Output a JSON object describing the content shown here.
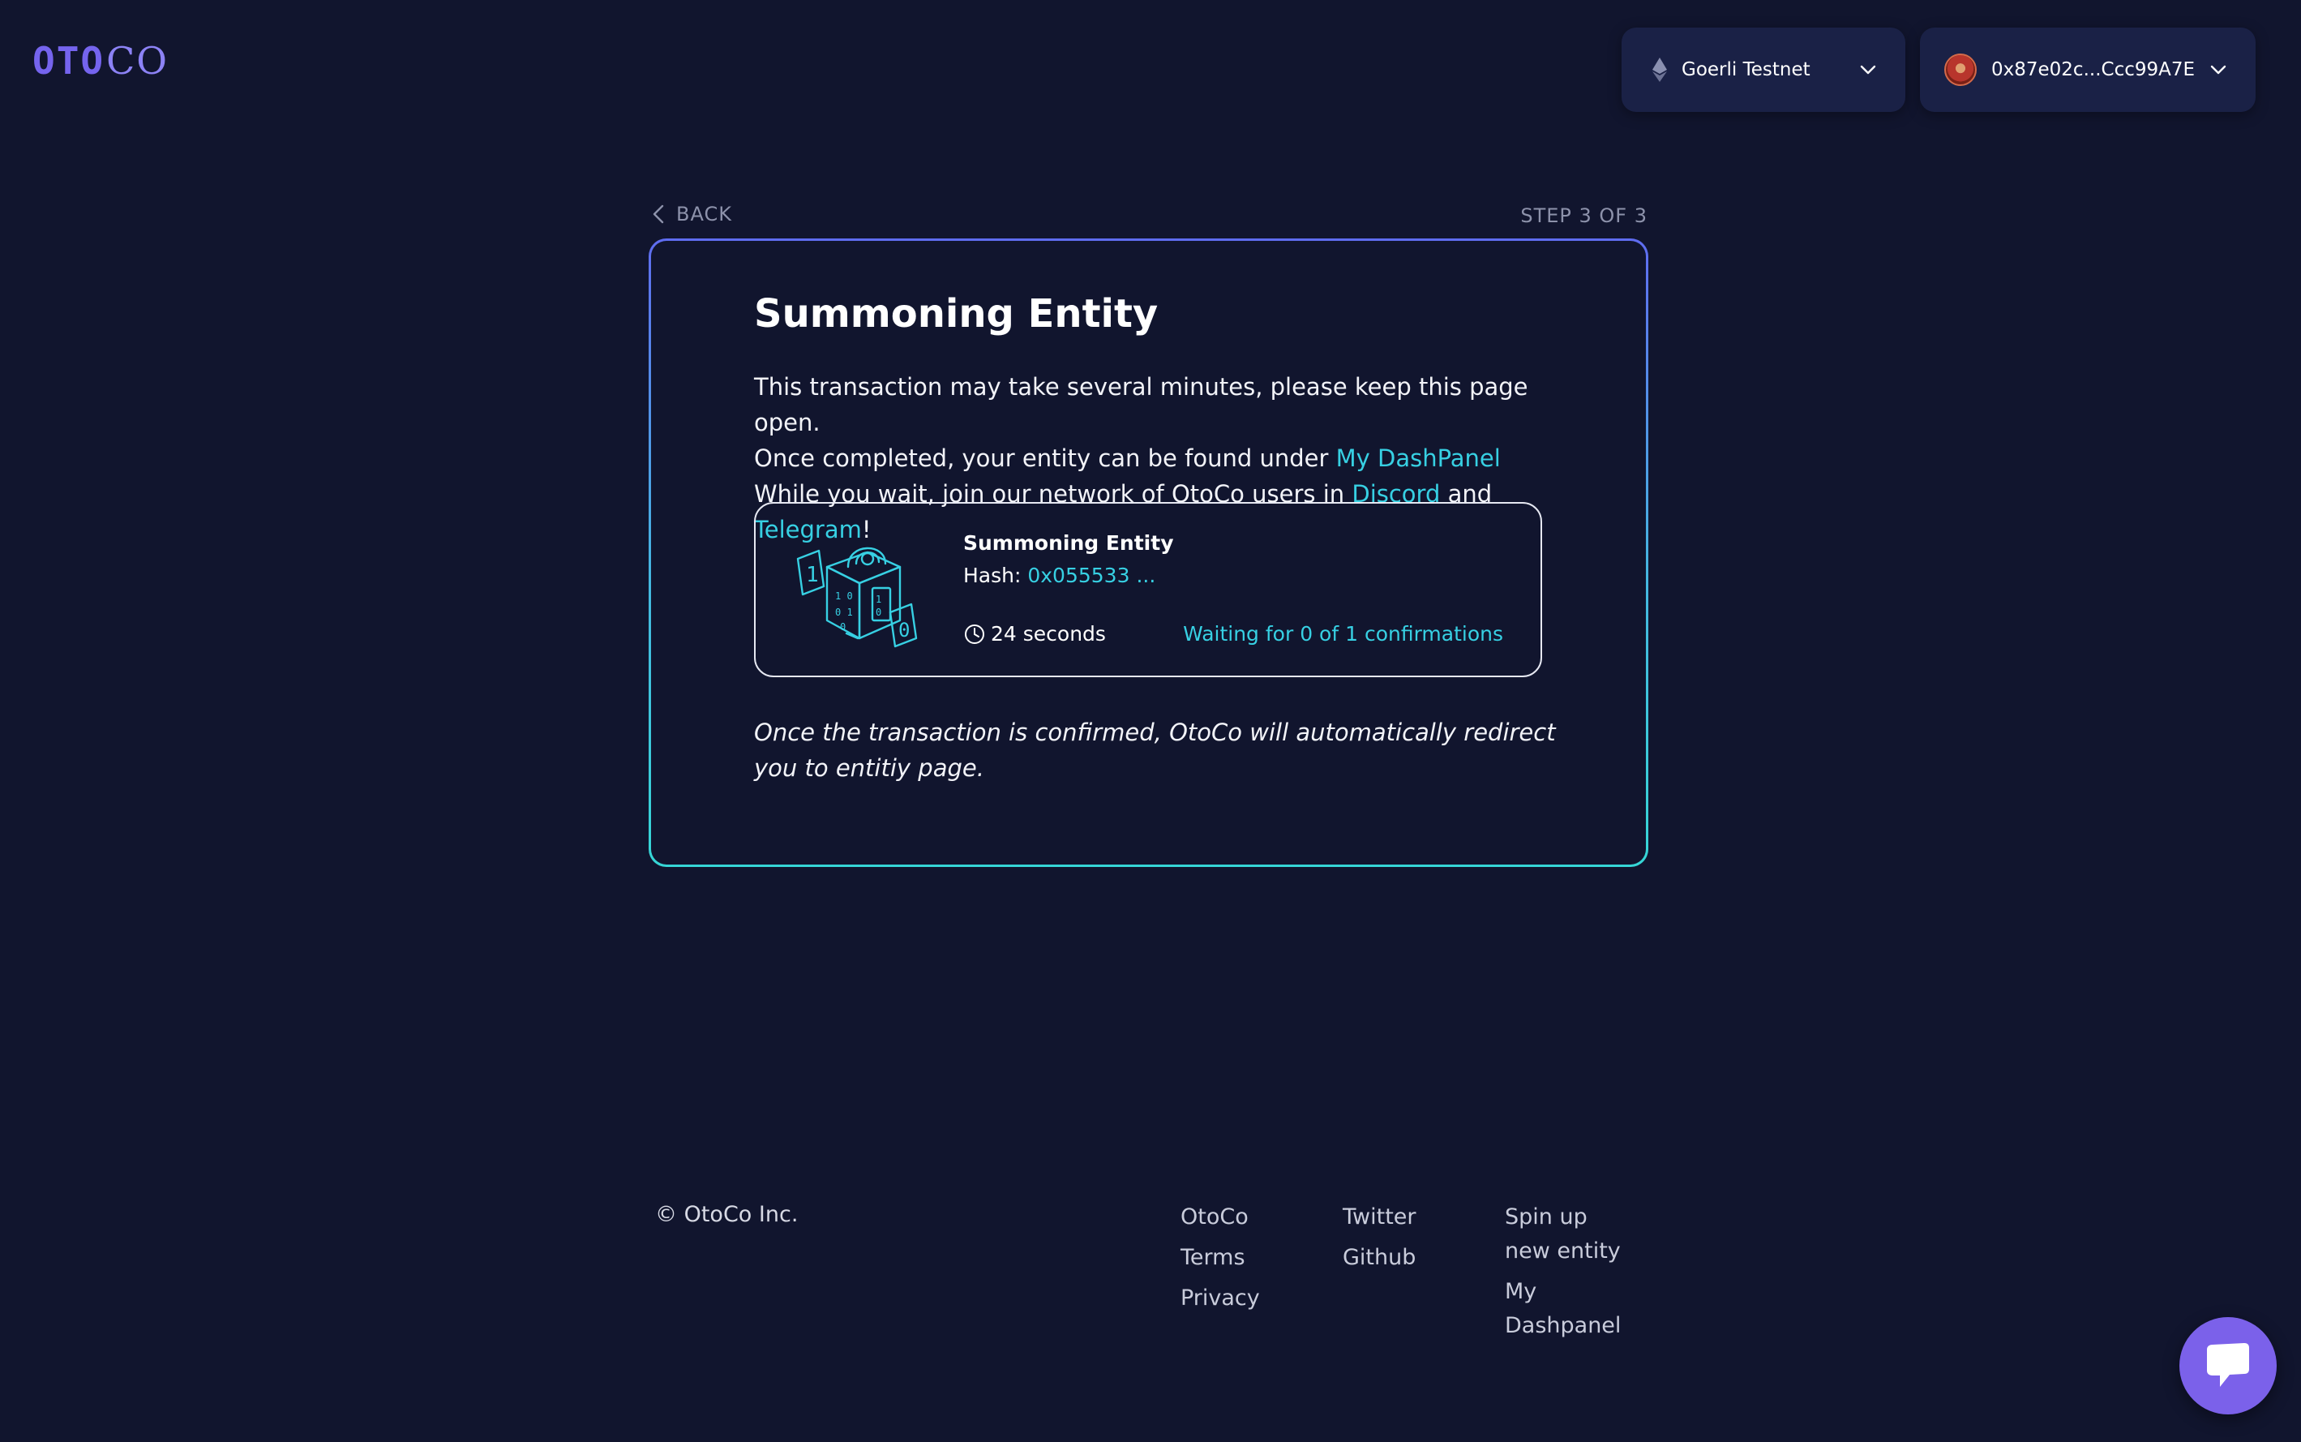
{
  "header": {
    "logo_left": "OTO",
    "logo_right": "CO",
    "network": "Goerli Testnet",
    "wallet": "0x87e02c...Ccc99A7E"
  },
  "nav": {
    "back": "BACK",
    "step": "STEP 3 OF 3"
  },
  "card": {
    "title": "Summoning Entity",
    "line1": "This transaction may take several minutes, please keep this page open.",
    "line2_prefix": "Once completed, your entity can be found under ",
    "line2_link": "My DashPanel",
    "line3_prefix": "While you wait, join our network of OtoCo users in ",
    "line3_link1": "Discord",
    "line3_mid": " and ",
    "line3_link2": "Telegram",
    "line3_suffix": "!",
    "tx": {
      "title": "Summoning Entity",
      "hash_label": "Hash: ",
      "hash_value": "0x055533 ...",
      "elapsed": "24 seconds",
      "confirmations": "Waiting for 0 of 1 confirmations"
    },
    "redirect_note": "Once the transaction is confirmed, OtoCo will automatically redirect you to entitiy page."
  },
  "footer": {
    "copyright": "© OtoCo Inc.",
    "col1": [
      "OtoCo",
      "Terms",
      "Privacy"
    ],
    "col2": [
      "Twitter",
      "Github"
    ],
    "col3": [
      "Spin up new entity",
      "My Dashpanel"
    ]
  },
  "colors": {
    "background": "#11152e",
    "accent_cyan": "#37d0e3",
    "accent_purple": "#7b61ea",
    "panel": "#1a2146"
  },
  "icons": {
    "network": "ethereum-icon",
    "dropdown": "chevron-down-icon",
    "back": "chevron-left-icon",
    "time": "clock-icon",
    "chat": "chat-bubble-icon"
  }
}
